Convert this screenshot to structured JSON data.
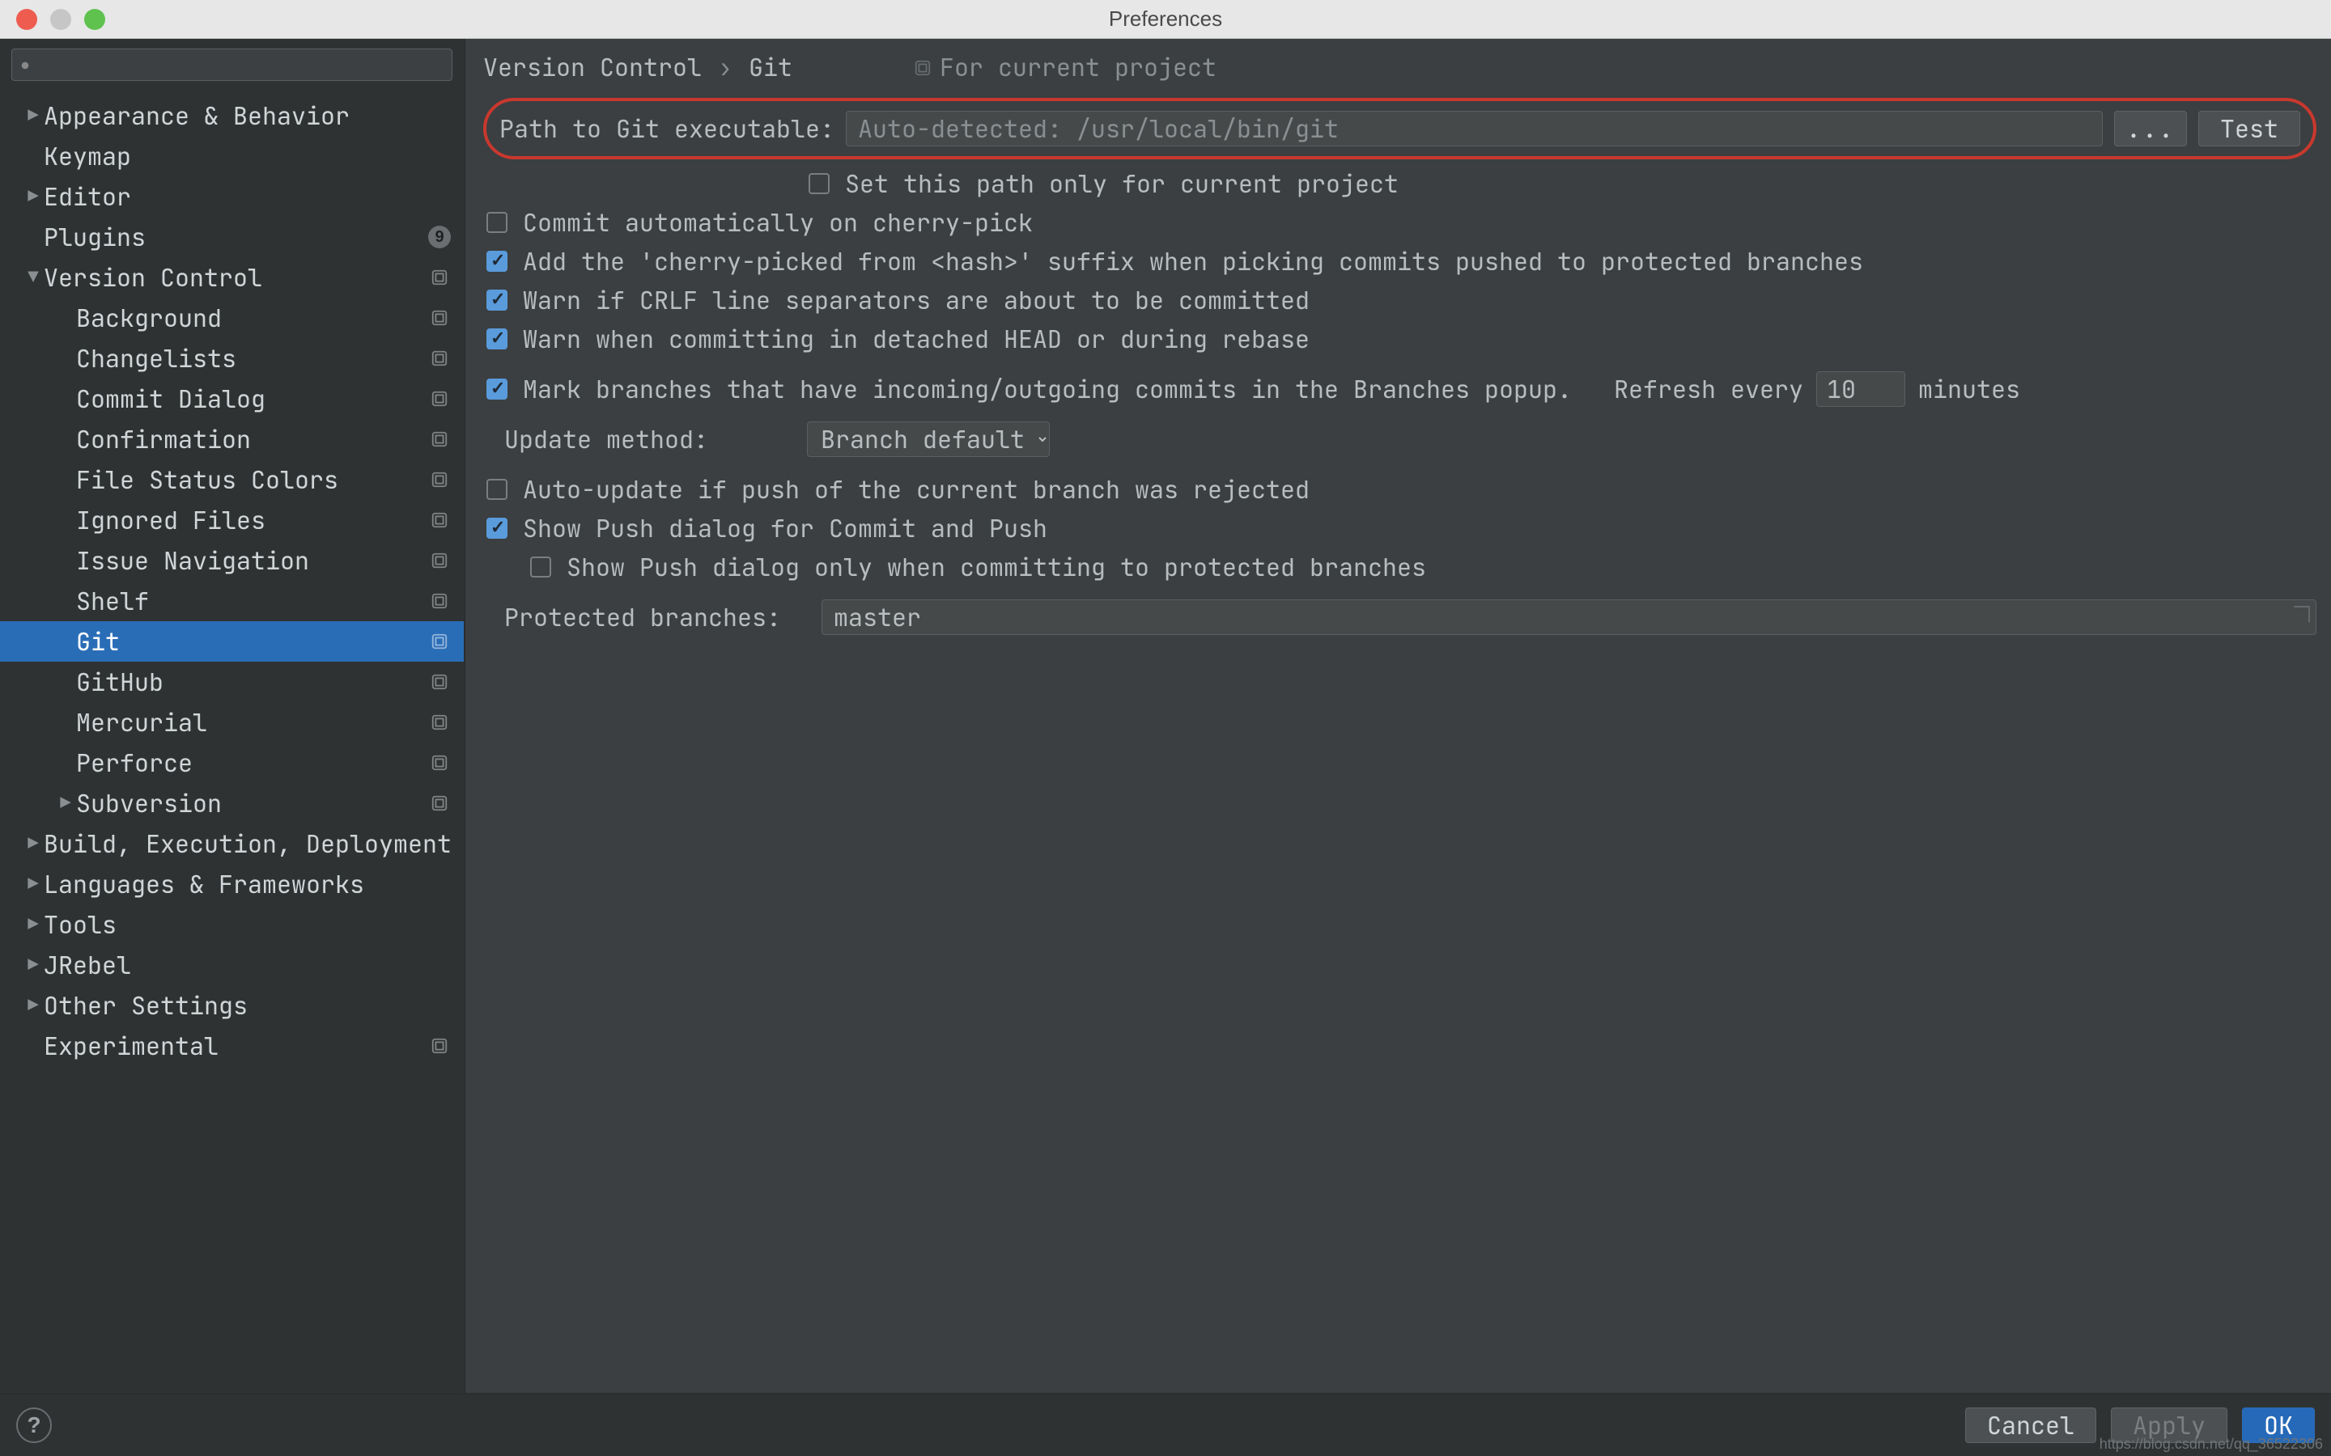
{
  "window": {
    "title": "Preferences"
  },
  "titlebar": {
    "dots": [
      "#ee5c50",
      "#c6c6c6",
      "#5fc24f"
    ]
  },
  "sidebar": {
    "search_placeholder": "",
    "items": [
      {
        "label": "Appearance & Behavior",
        "depth": 0,
        "arrow": "▶",
        "disclosure": true
      },
      {
        "label": "Keymap",
        "depth": 0
      },
      {
        "label": "Editor",
        "depth": 0,
        "arrow": "▶",
        "disclosure": true
      },
      {
        "label": "Plugins",
        "depth": 0,
        "badge": "9"
      },
      {
        "label": "Version Control",
        "depth": 0,
        "arrow": "▼",
        "disclosure": true,
        "tag": true
      },
      {
        "label": "Background",
        "depth": 1,
        "tag": true
      },
      {
        "label": "Changelists",
        "depth": 1,
        "tag": true
      },
      {
        "label": "Commit Dialog",
        "depth": 1,
        "tag": true
      },
      {
        "label": "Confirmation",
        "depth": 1,
        "tag": true
      },
      {
        "label": "File Status Colors",
        "depth": 1,
        "tag": true
      },
      {
        "label": "Ignored Files",
        "depth": 1,
        "tag": true
      },
      {
        "label": "Issue Navigation",
        "depth": 1,
        "tag": true
      },
      {
        "label": "Shelf",
        "depth": 1,
        "tag": true
      },
      {
        "label": "Git",
        "depth": 1,
        "tag": true,
        "selected": true
      },
      {
        "label": "GitHub",
        "depth": 1,
        "tag": true
      },
      {
        "label": "Mercurial",
        "depth": 1,
        "tag": true
      },
      {
        "label": "Perforce",
        "depth": 1,
        "tag": true
      },
      {
        "label": "Subversion",
        "depth": 1,
        "arrow": "▶",
        "disclosure": true,
        "tag": true
      },
      {
        "label": "Build, Execution, Deployment",
        "depth": 0,
        "arrow": "▶",
        "disclosure": true
      },
      {
        "label": "Languages & Frameworks",
        "depth": 0,
        "arrow": "▶",
        "disclosure": true
      },
      {
        "label": "Tools",
        "depth": 0,
        "arrow": "▶",
        "disclosure": true
      },
      {
        "label": "JRebel",
        "depth": 0,
        "arrow": "▶",
        "disclosure": true
      },
      {
        "label": "Other Settings",
        "depth": 0,
        "arrow": "▶",
        "disclosure": true
      },
      {
        "label": "Experimental",
        "depth": 0,
        "tag": true
      }
    ]
  },
  "breadcrumb": {
    "part1": "Version Control",
    "sep": "›",
    "part2": "Git",
    "note": "For current project"
  },
  "git": {
    "path_label": "Path to Git executable:",
    "path_placeholder": "Auto-detected: /usr/local/bin/git",
    "path_value": "",
    "browse_label": "...",
    "test_label": "Test",
    "set_path_only": {
      "label": "Set this path only for current project",
      "checked": false
    },
    "cherry_auto": {
      "label": "Commit automatically on cherry-pick",
      "checked": false
    },
    "cherry_suffix": {
      "label": "Add the 'cherry-picked from <hash>' suffix when picking commits pushed to protected branches",
      "checked": true
    },
    "warn_crlf": {
      "label": "Warn if CRLF line separators are about to be committed",
      "checked": true
    },
    "warn_detached": {
      "label": "Warn when committing in detached HEAD or during rebase",
      "checked": true
    },
    "mark_branches": {
      "label": "Mark branches that have incoming/outgoing commits in the Branches popup.",
      "checked": true
    },
    "refresh_every_label": "Refresh every",
    "refresh_value": "10",
    "minutes_label": "minutes",
    "update_method_label": "Update method:",
    "update_method_value": "Branch default",
    "auto_update": {
      "label": "Auto-update if push of the current branch was rejected",
      "checked": false
    },
    "show_push_dialog": {
      "label": "Show Push dialog for Commit and Push",
      "checked": true
    },
    "show_push_protected": {
      "label": "Show Push dialog only when committing to protected branches",
      "checked": false
    },
    "protected_label": "Protected branches:",
    "protected_value": "master"
  },
  "footer": {
    "cancel": "Cancel",
    "apply": "Apply",
    "ok": "OK"
  },
  "watermark": "https://blog.csdn.net/qq_36522306"
}
